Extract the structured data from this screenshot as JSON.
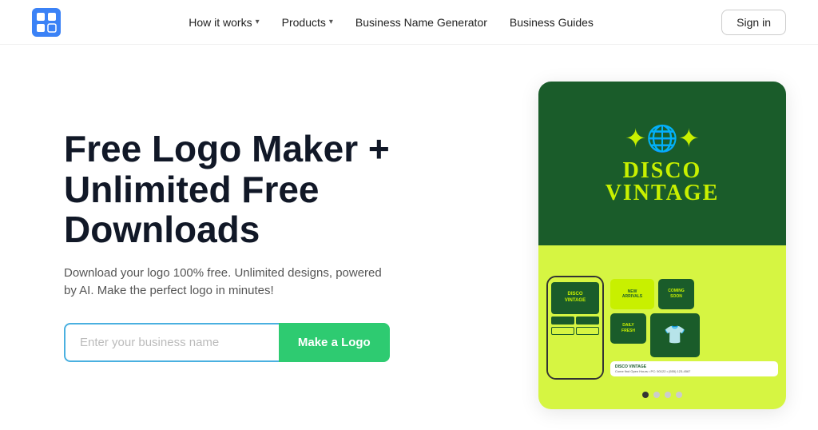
{
  "nav": {
    "logo_alt": "Logo",
    "links": [
      {
        "label": "How it works",
        "has_chevron": true
      },
      {
        "label": "Products",
        "has_chevron": true
      },
      {
        "label": "Business Name Generator",
        "has_chevron": false
      },
      {
        "label": "Business Guides",
        "has_chevron": false
      }
    ],
    "sign_in": "Sign in"
  },
  "hero": {
    "headline_line1": "Free Logo Maker +",
    "headline_line2": "Unlimited Free",
    "headline_line3": "Downloads",
    "subtext": "Download your logo 100% free. Unlimited designs, powered by AI. Make the perfect logo in minutes!",
    "input_placeholder": "Enter your business name",
    "cta_button": "Make a Logo"
  },
  "carousel": {
    "brand_name_line1": "DISCO",
    "brand_name_line2": "VINTAGE",
    "dots": [
      true,
      false,
      false,
      false
    ]
  },
  "colors": {
    "accent_blue": "#4ab0e0",
    "accent_green": "#2ecb71",
    "dark_green": "#1a5c2a",
    "lime": "#c8f000",
    "lime_bg": "#d6f542"
  }
}
